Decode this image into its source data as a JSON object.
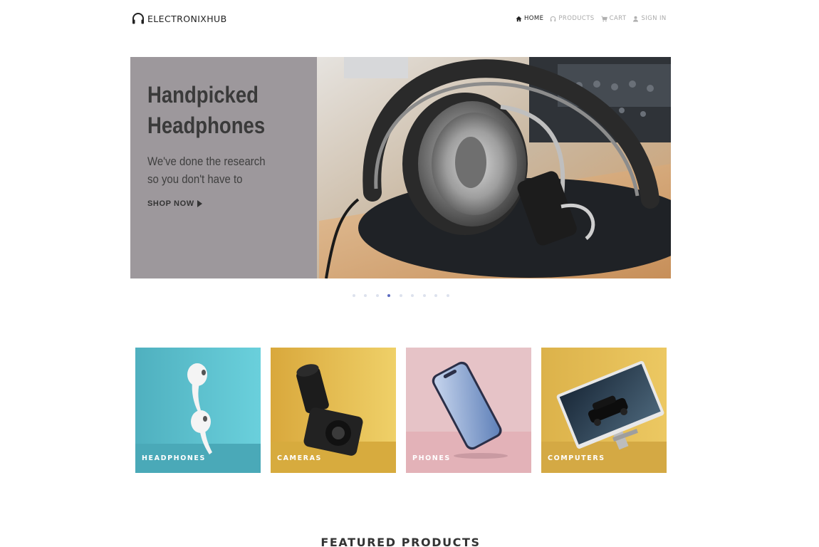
{
  "brand": {
    "name": "ELECTRONIXHUB",
    "icon": "headphones-icon"
  },
  "nav": {
    "home": "HOME",
    "products": "PRODUCTS",
    "cart": "CART",
    "sign_in": "SIGN IN"
  },
  "hero": {
    "title": "Handpicked Headphones",
    "subtitle": "We've done the research so you don't have to",
    "cta": "SHOP NOW"
  },
  "carousel": {
    "slide_count": 9,
    "active_slide": 4
  },
  "categories": [
    {
      "label": "HEADPHONES"
    },
    {
      "label": "CAMERAS"
    },
    {
      "label": "PHONES"
    },
    {
      "label": "COMPUTERS"
    }
  ],
  "featured": {
    "heading": "FEATURED PRODUCTS"
  },
  "colors": {
    "accent": "#5c6bc0",
    "hero_panel": "#9d989c",
    "headphones_bg": "#5fc3ce",
    "cameras_bg": "#e3b64a",
    "phones_bg": "#e8c4c8",
    "computers_bg": "#e5bd52"
  }
}
